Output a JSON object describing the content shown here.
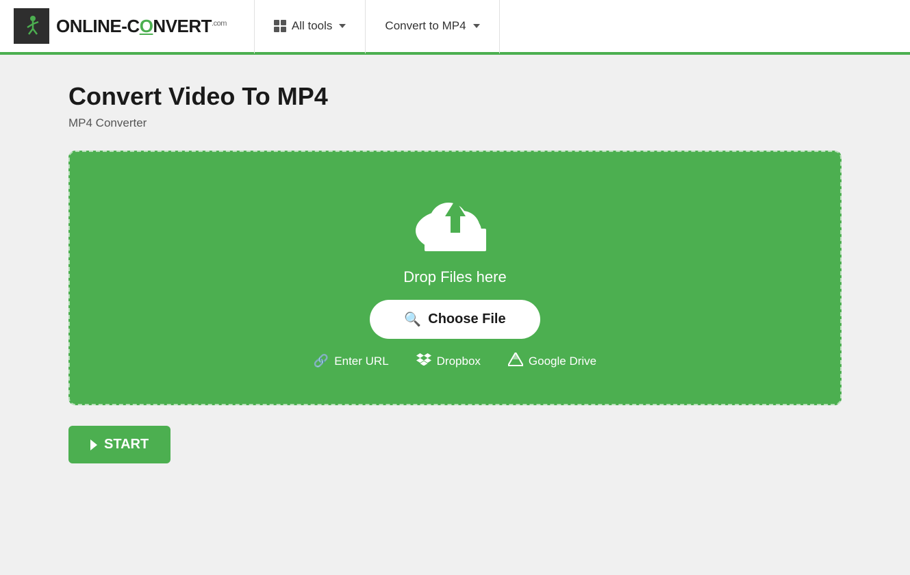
{
  "header": {
    "logo": {
      "text_online": "ONLINE",
      "text_dash": "-",
      "text_convert": "CONVERT",
      "text_com": ".com"
    },
    "nav_all_tools": "All tools",
    "nav_convert_to": "Convert to MP4"
  },
  "main": {
    "page_title": "Convert Video To MP4",
    "page_subtitle": "MP4 Converter",
    "upload": {
      "drop_text": "Drop Files here",
      "choose_file_label": "Choose File",
      "enter_url_label": "Enter URL",
      "dropbox_label": "Dropbox",
      "google_drive_label": "Google Drive"
    },
    "start_button_label": "START"
  }
}
